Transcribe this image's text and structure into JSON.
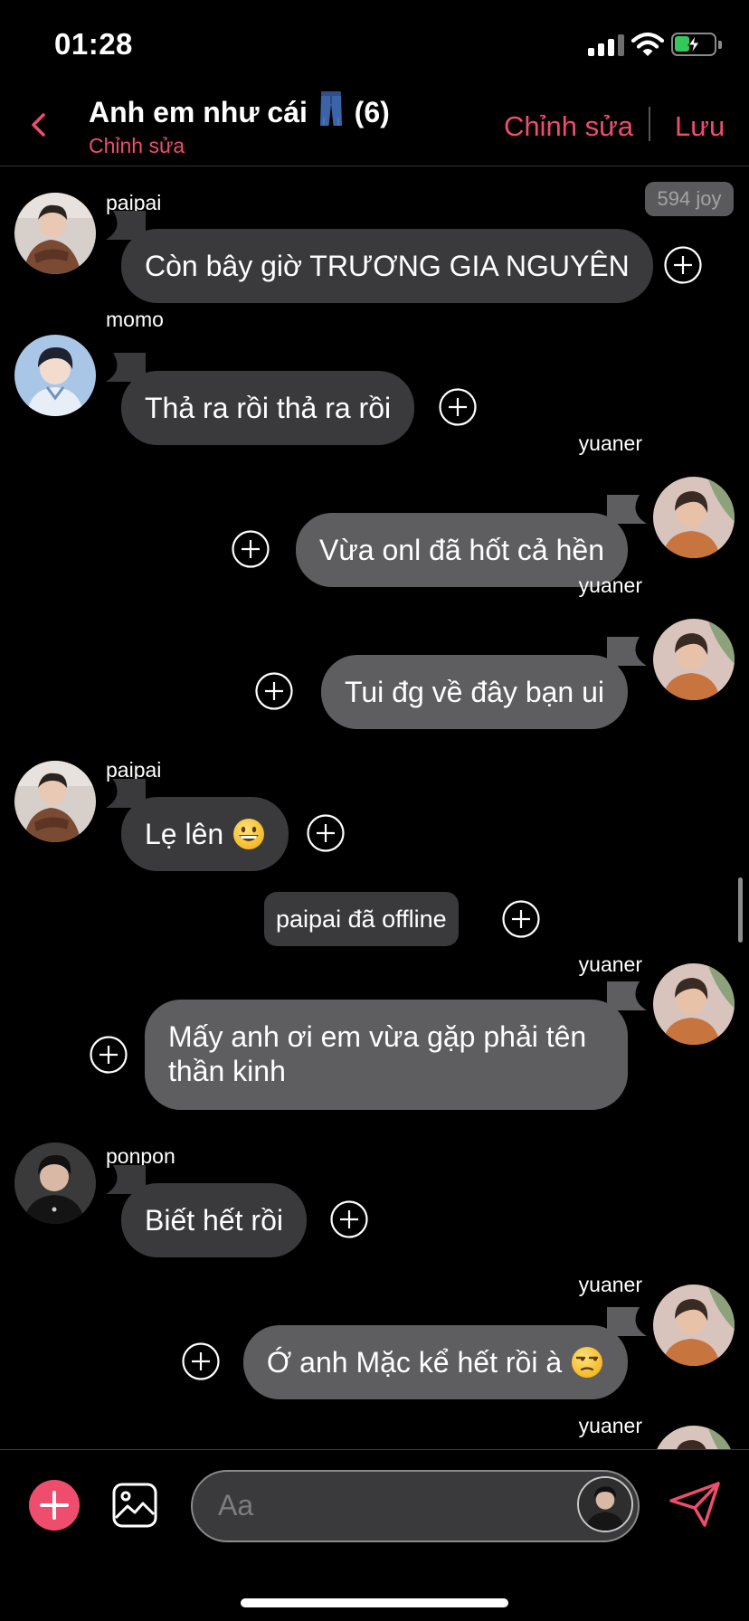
{
  "status_bar": {
    "time": "01:28",
    "battery_charging": true
  },
  "header": {
    "title": "Anh em như cái",
    "title_emoji": "jeans-icon",
    "member_count": "(6)",
    "subtitle": "Chỉnh sửa",
    "edit_label": "Chỉnh sửa",
    "save_label": "Lưu"
  },
  "chat": {
    "joy_badge": "594 joy",
    "messages": [
      {
        "sender": "paipai",
        "text": "Còn bây giờ TRƯƠNG GIA NGUYÊN",
        "direction": "incoming"
      },
      {
        "sender": "momo",
        "text": "Thả ra rồi thả ra rồi",
        "direction": "incoming"
      },
      {
        "sender": "yuaner",
        "text": "Vừa onl đã hốt cả hền",
        "direction": "outgoing"
      },
      {
        "sender": "yuaner",
        "text": "Tui đg về đây bạn ui",
        "direction": "outgoing"
      },
      {
        "sender": "paipai",
        "text": "Lẹ lên",
        "emoji": "grinning-face",
        "direction": "incoming"
      },
      {
        "system": "paipai đã offline"
      },
      {
        "sender": "yuaner",
        "text": "Mấy anh ơi em vừa gặp phải tên thần kinh",
        "direction": "outgoing"
      },
      {
        "sender": "ponpon",
        "text": "Biết hết rồi",
        "direction": "incoming"
      },
      {
        "sender": "yuaner",
        "text": "Ớ anh Mặc kể hết rồi à",
        "emoji": "unamused-face",
        "direction": "outgoing"
      },
      {
        "sender": "yuaner",
        "direction": "outgoing"
      }
    ]
  },
  "input": {
    "placeholder": "Aa"
  },
  "colors": {
    "accent": "#ef4d6e",
    "incoming_bubble": "#3a3a3c",
    "outgoing_bubble": "#5e5e60",
    "background": "#000000"
  }
}
